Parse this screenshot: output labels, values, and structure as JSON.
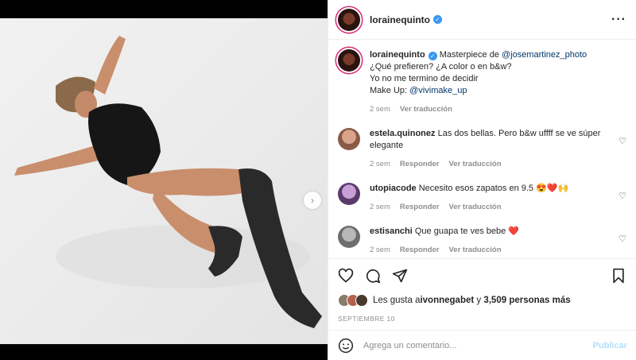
{
  "post": {
    "username": "lorainequinto",
    "caption": {
      "prefix": "Masterpiece de ",
      "mention_photographer": "@josemartinez_photo",
      "line2": "¿Qué prefieren? ¿A color o en b&w?",
      "line3": "Yo no me termino de decidir",
      "line4_prefix": "Make Up: ",
      "mention_makeup": "@vivimake_up",
      "time": "2 sem",
      "see_translation": "Ver traducción"
    }
  },
  "comments": [
    {
      "username": "estela.quinonez",
      "text": "Las dos bellas. Pero b&w uffff se ve súper elegante",
      "time": "2 sem",
      "reply": "Responder",
      "translate": "Ver traducción"
    },
    {
      "username": "utopiacode",
      "text": "Necesito esos zapatos en 9.5 😍❤️🙌",
      "time": "2 sem",
      "reply": "Responder",
      "translate": "Ver traducción"
    },
    {
      "username": "estisanchi",
      "text": "Que guapa te ves bebe ❤️",
      "time": "2 sem",
      "reply": "Responder",
      "translate": "Ver traducción"
    }
  ],
  "likes": {
    "prefix": "Les gusta a ",
    "user": "ivonnegabet",
    "middle": " y ",
    "others": "3,509 personas más"
  },
  "date": "SEPTIEMBRE 10",
  "comment_box": {
    "placeholder": "Agrega un comentario...",
    "publish": "Publicar"
  },
  "icons": {
    "verified": "verified-badge-icon",
    "more": "more-options-icon",
    "like": "heart-icon",
    "comment": "comment-icon",
    "share": "paper-plane-icon",
    "save": "bookmark-icon",
    "emoji": "emoji-icon",
    "next": "chevron-right-icon"
  },
  "colors": {
    "link": "#00376b",
    "verified": "#3897f0",
    "publish_disabled": "#b2dffc",
    "heart_red": "#ed4956"
  }
}
